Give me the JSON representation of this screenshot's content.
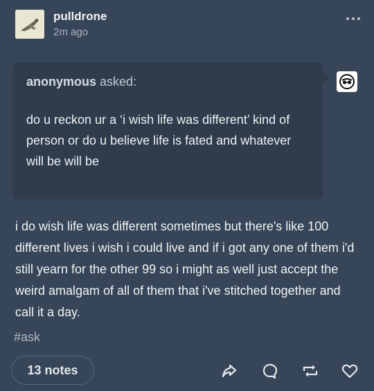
{
  "post": {
    "author": "pulldrone",
    "timestamp": "2m ago",
    "asker_name": "anonymous",
    "asker_verb": "asked:",
    "question": "do u reckon ur a ‘i wish life was different’ kind of person or do u believe life is fated and whatever will be will be",
    "answer": "i do wish life was different sometimes but there's like 100 different lives i wish i could live and if i got any one of them i'd still yearn for the other 99 so i might as well just accept the weird amalgam of all of them that i've stitched together and call it a day.",
    "tag": "#ask",
    "notes_label": "13 notes"
  },
  "icons": {
    "more": "more-dots-icon",
    "share": "share-icon",
    "reply": "reply-icon",
    "reblog": "reblog-icon",
    "like": "heart-icon",
    "anon": "anonymous-avatar-icon"
  },
  "colors": {
    "background": "#364557",
    "ask_box": "#2f3c4c",
    "text": "#f2f4f6",
    "muted": "#aab4c0"
  }
}
